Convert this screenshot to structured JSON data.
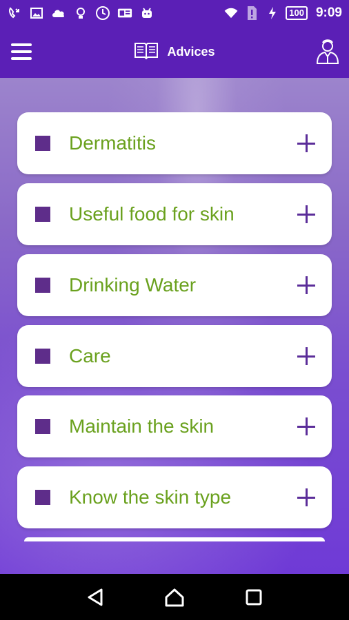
{
  "status_bar": {
    "battery": "100",
    "time": "9:09"
  },
  "app_bar": {
    "title": "Advices"
  },
  "advices": [
    {
      "label": "Dermatitis"
    },
    {
      "label": "Useful food for skin"
    },
    {
      "label": "Drinking Water"
    },
    {
      "label": "Care"
    },
    {
      "label": "Maintain the skin"
    },
    {
      "label": "Know the skin type"
    }
  ],
  "colors": {
    "primary": "#5b1fb6",
    "label_green": "#6aa11e",
    "bullet_purple": "#5e2d8a"
  }
}
